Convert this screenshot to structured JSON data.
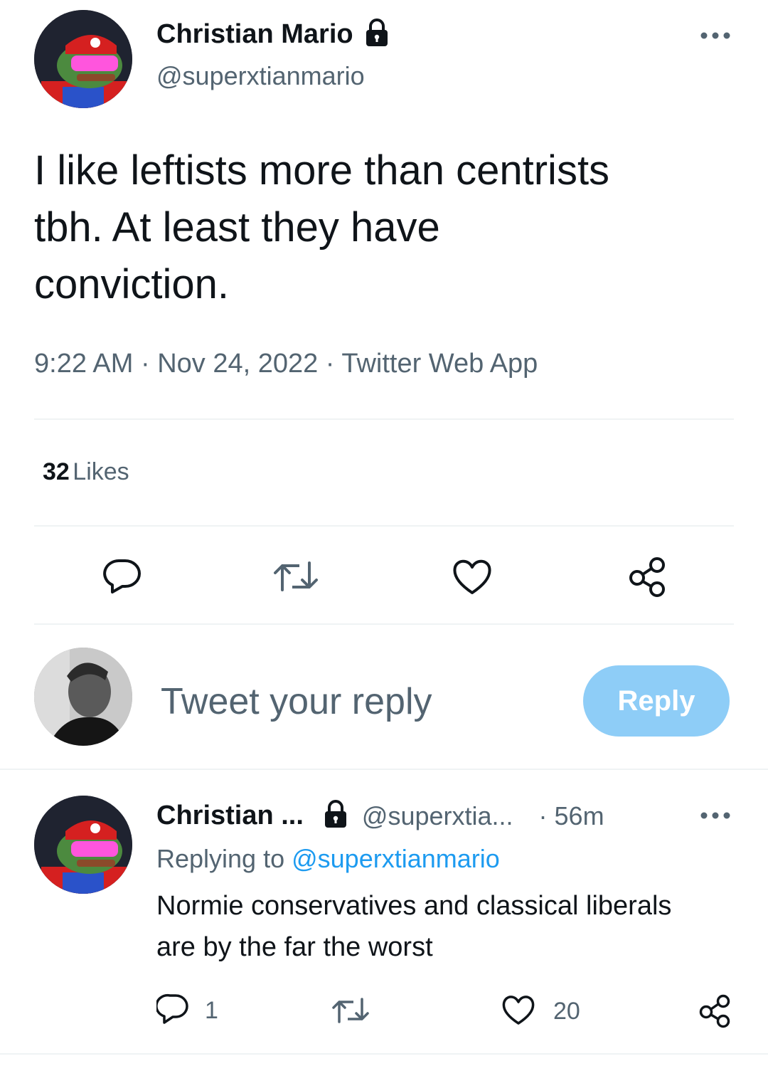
{
  "tweet": {
    "author_name": "Christian Mario",
    "author_handle": "@superxtianmario",
    "text_line1": "I like leftists more than centrists",
    "text_line2": "tbh. At least they have",
    "text_line3": "conviction.",
    "meta": "9:22 AM · Nov 24, 2022 · Twitter Web App",
    "likes_count": "32",
    "likes_label": "Likes",
    "icons": [
      "lock-icon",
      "more-icon",
      "reply-icon",
      "retweet-icon",
      "like-icon",
      "share-icon"
    ]
  },
  "composer": {
    "placeholder": "Tweet your reply",
    "button_label": "Reply"
  },
  "reply": {
    "author_name": "Christian ...",
    "author_handle": "@superxtia...",
    "time": "· 56m",
    "replying_prefix": "Replying to ",
    "replying_handle": "@superxtianmario",
    "text_line1": "Normie conservatives and classical liberals",
    "text_line2": "are by the far the worst",
    "reply_count": "1",
    "like_count": "20"
  },
  "colors": {
    "link": "#1d9bf0",
    "reply_button": "#8ecdf7",
    "secondary_text": "#536471",
    "divider": "#eff3f4"
  }
}
